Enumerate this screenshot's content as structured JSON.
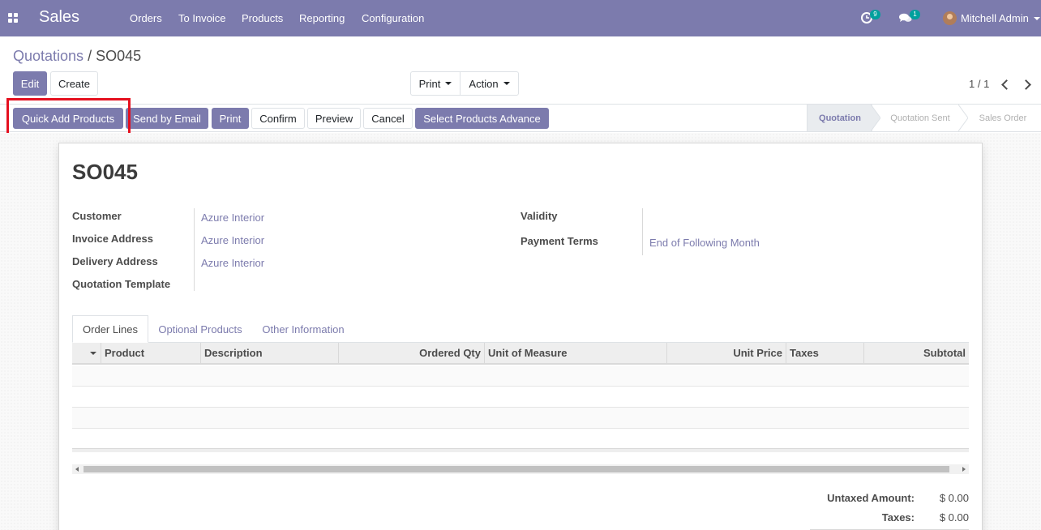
{
  "navbar": {
    "app_title": "Sales",
    "menu": [
      "Orders",
      "To Invoice",
      "Products",
      "Reporting",
      "Configuration"
    ],
    "activity_count": "9",
    "messages_count": "1",
    "user_name": "Mitchell Admin"
  },
  "breadcrumb": {
    "parent": "Quotations",
    "separator": "/",
    "current": "SO045"
  },
  "control": {
    "edit": "Edit",
    "create": "Create",
    "print": "Print",
    "action": "Action",
    "pager": "1 / 1"
  },
  "statusbar": {
    "buttons": {
      "quick_add": "Quick Add Products",
      "send_email": "Send by Email",
      "print": "Print",
      "confirm": "Confirm",
      "preview": "Preview",
      "cancel": "Cancel",
      "select_advance": "Select Products Advance"
    },
    "stages": [
      "Quotation",
      "Quotation Sent",
      "Sales Order"
    ],
    "active_stage": "Quotation"
  },
  "form": {
    "name": "SO045",
    "left_fields": [
      {
        "label": "Customer",
        "value": "Azure Interior"
      },
      {
        "label": "Invoice Address",
        "value": "Azure Interior"
      },
      {
        "label": "Delivery Address",
        "value": "Azure Interior"
      },
      {
        "label": "Quotation Template",
        "value": ""
      }
    ],
    "right_fields": [
      {
        "label": "Validity",
        "value": ""
      },
      {
        "label": "Payment Terms",
        "value": "End of Following Month"
      }
    ]
  },
  "tabs": [
    "Order Lines",
    "Optional Products",
    "Other Information"
  ],
  "table": {
    "columns": [
      "Product",
      "Description",
      "Ordered Qty",
      "Unit of Measure",
      "Unit Price",
      "Taxes",
      "Subtotal"
    ]
  },
  "totals": [
    {
      "label": "Untaxed Amount:",
      "value": "$ 0.00"
    },
    {
      "label": "Taxes:",
      "value": "$ 0.00"
    }
  ],
  "colors": {
    "brand": "#7c7bad",
    "badge": "#00a09d",
    "highlight": "#e5101f"
  }
}
